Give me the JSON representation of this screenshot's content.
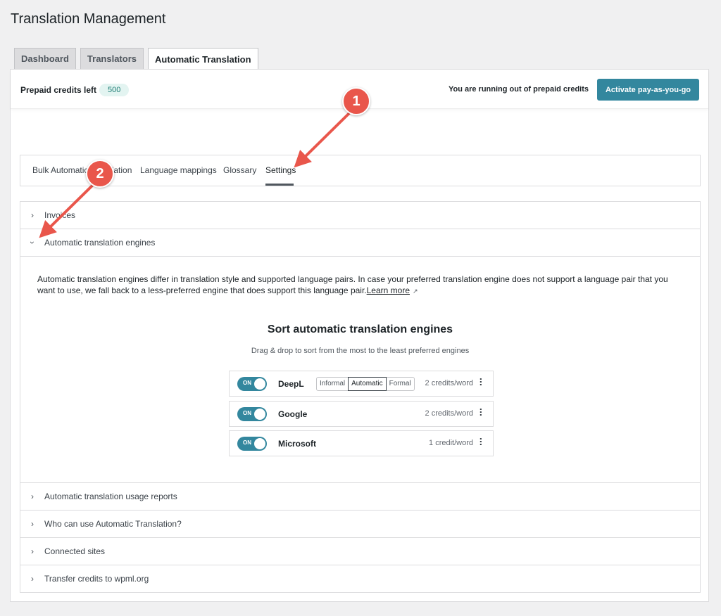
{
  "page": {
    "title": "Translation Management"
  },
  "main_tabs": [
    {
      "label": "Dashboard"
    },
    {
      "label": "Translators"
    },
    {
      "label": "Automatic Translation"
    }
  ],
  "credits": {
    "label": "Prepaid credits left",
    "value": "500",
    "warning": "You are running out of prepaid credits",
    "activate_label": "Activate pay-as-you-go"
  },
  "sub_tabs": [
    {
      "label": "Bulk Automatic Translation"
    },
    {
      "label": "Language mappings"
    },
    {
      "label": "Glossary"
    },
    {
      "label": "Settings"
    }
  ],
  "sections": {
    "invoices": "Invoices",
    "engines": "Automatic translation engines",
    "usage": "Automatic translation usage reports",
    "who": "Who can use Automatic Translation?",
    "sites": "Connected sites",
    "transfer": "Transfer credits to wpml.org"
  },
  "engines_section": {
    "description": "Automatic translation engines differ in translation style and supported language pairs. In case your preferred translation engine does not support a language pair that you want to use, we fall back to a less-preferred engine that does support this language pair.",
    "learn_more": "Learn more",
    "sort_title": "Sort automatic translation engines",
    "sort_subtitle": "Drag & drop to sort from the most to the least preferred engines",
    "toggle_label": "ON",
    "engines": [
      {
        "name": "DeepL",
        "credits": "2 credits/word",
        "styles": [
          "Informal",
          "Automatic",
          "Formal"
        ],
        "selected_style": "Automatic"
      },
      {
        "name": "Google",
        "credits": "2 credits/word"
      },
      {
        "name": "Microsoft",
        "credits": "1 credit/word"
      }
    ]
  },
  "annotations": [
    {
      "label": "1"
    },
    {
      "label": "2"
    }
  ],
  "colors": {
    "accent": "#33879e",
    "marker": "#e9564b",
    "badge_bg": "#e3f4f1"
  }
}
